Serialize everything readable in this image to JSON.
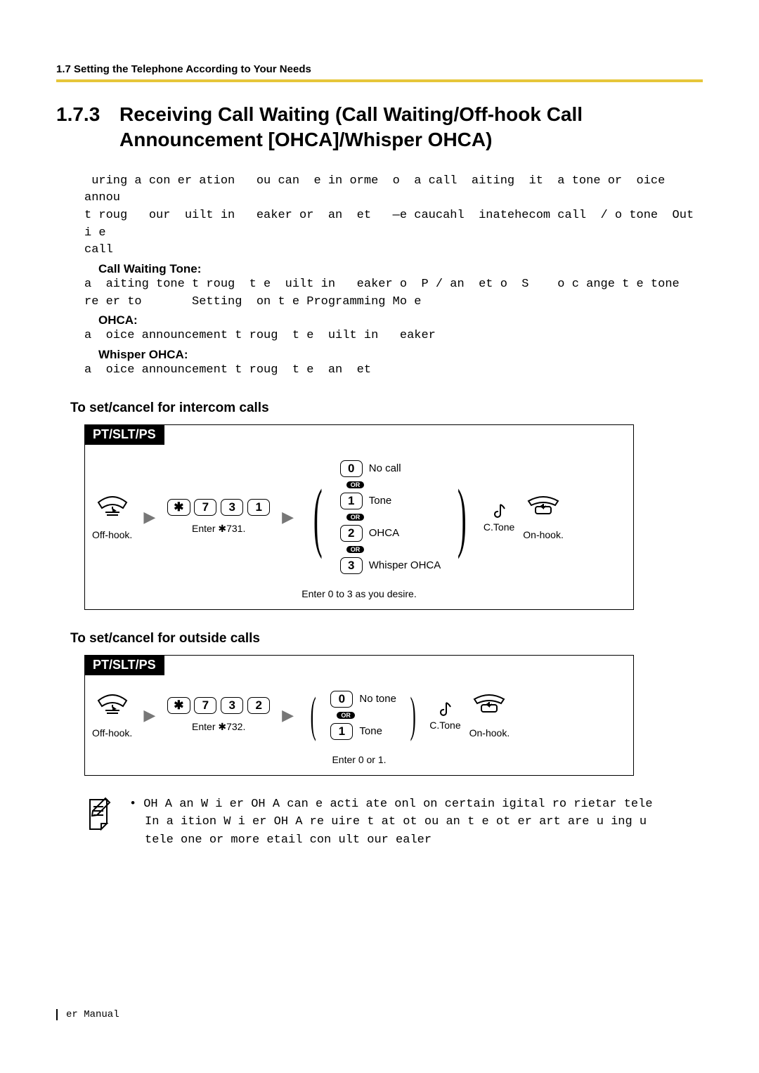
{
  "header": {
    "running": "1.7 Setting the Telephone According to Your Needs"
  },
  "section": {
    "number": "1.7.3",
    "title": "Receiving Call Waiting (Call Waiting/Off-hook Call Announcement [OHCA]/Whisper OHCA)"
  },
  "para1a": " uring a con er ation   ou can  e in orme  o  a call  aiting  it  a tone or  oice annou",
  "para1b": "t roug   our  uilt in   eaker or  an  et   —e caucahl  inatehecom call  / o tone  Out i e",
  "para1c": "call",
  "cwt_label": "Call Waiting Tone:",
  "cwt_line1": "a  aiting tone t roug  t e  uilt in   eaker o  P / an  et o  S    o c ange t e tone",
  "cwt_line2": "re er to       Setting  on t e Programming Mo e",
  "ohca_label": "OHCA:",
  "ohca_line": "a  oice announcement t roug  t e  uilt in   eaker",
  "whisper_label": "Whisper OHCA:",
  "whisper_line": "a  oice announcement t roug  t e  an  et",
  "sub1": "To set/cancel for intercom calls",
  "sub2": "To set/cancel for outside calls",
  "diag": {
    "tab": "PT/SLT/PS",
    "offhook": "Off-hook.",
    "onhook": "On-hook.",
    "ctone": "C.Tone",
    "enter731": "Enter ✱731.",
    "enter732": "Enter ✱732.",
    "keys731": [
      "✱",
      "7",
      "3",
      "1"
    ],
    "keys732": [
      "✱",
      "7",
      "3",
      "2"
    ],
    "opts1": [
      {
        "k": "0",
        "t": "No call"
      },
      {
        "k": "1",
        "t": "Tone"
      },
      {
        "k": "2",
        "t": "OHCA"
      },
      {
        "k": "3",
        "t": "Whisper OHCA"
      }
    ],
    "opts1_or": "OR",
    "opts1_sub": "Enter 0 to 3 as you desire.",
    "opts2": [
      {
        "k": "0",
        "t": "No tone"
      },
      {
        "k": "1",
        "t": "Tone"
      }
    ],
    "opts2_sub": "Enter 0 or 1."
  },
  "note": {
    "l1": "OH A an  W i  er OH A can  e acti ate  onl  on certain  igital  ro rietar  tele ",
    "l2": "In a  ition  W i  er OH A re uire  t at  ot   ou an  t e ot er  art  are u ing  u",
    "l3": "tele  one    or more  etail   con ult  our  ealer"
  },
  "footer": " er Manual"
}
